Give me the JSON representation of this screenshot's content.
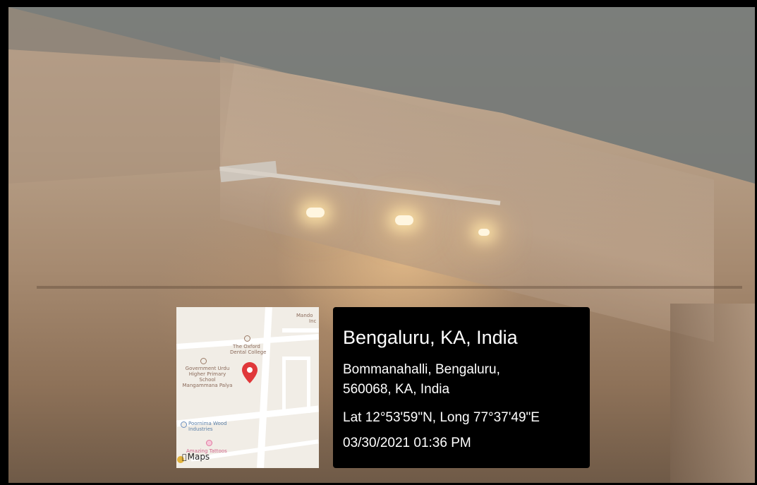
{
  "map": {
    "labels": {
      "mando": "Mando",
      "mando2": "Inc",
      "oxford": "The Oxford",
      "oxford2": "Dental College",
      "urdu1": "Government Urdu",
      "urdu2": "Higher Primary",
      "urdu3": "School",
      "urdu4": "Mangammana Palya",
      "poornima1": "Poornima Wood",
      "poornima2": "Industries",
      "tattoos": "Amazing Tattoos"
    },
    "logo": "Maps",
    "pin_color": "#e0383a"
  },
  "location": {
    "title": "Bengaluru, KA, India",
    "address_line1": "Bommanahalli, Bengaluru,",
    "address_line2": "560068, KA, India",
    "coordinates": "Lat 12°53'59\"N, Long 77°37'49\"E",
    "timestamp": "03/30/2021 01:36 PM"
  }
}
